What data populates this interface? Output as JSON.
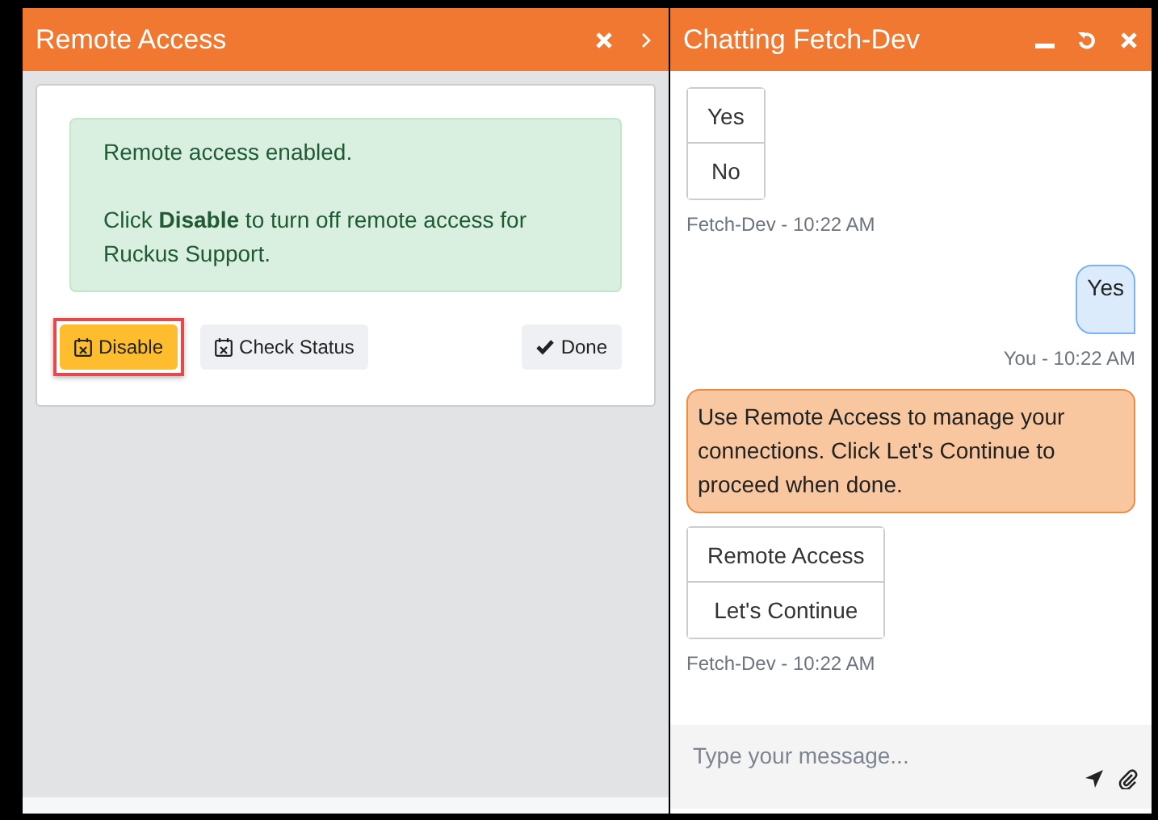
{
  "remote_panel": {
    "title": "Remote Access",
    "alert": {
      "lines": [
        "Remote access enabled.",
        "Click **Disable** to turn off remote access for Ruckus Support."
      ]
    },
    "buttons": [
      {
        "label": "Disable",
        "kind": "warning",
        "highlighted": true
      },
      {
        "label": "Check Status",
        "kind": "light",
        "highlighted": false
      },
      {
        "label": "Done",
        "kind": "light",
        "highlighted": false
      }
    ]
  },
  "chat_panel": {
    "title": "Chatting Fetch-Dev",
    "messages": [
      {
        "kind": "options",
        "options": [
          "Yes",
          "No"
        ],
        "meta": "Fetch-Dev - 10:22 AM"
      },
      {
        "kind": "user",
        "text": "Yes",
        "meta": "You - 10:22 AM"
      },
      {
        "kind": "bot",
        "text": "Use Remote Access to manage your connections. Click Let's Continue to proceed when done."
      },
      {
        "kind": "options",
        "options": [
          "Remote Access",
          "Let's Continue"
        ],
        "meta": "Fetch-Dev - 10:22 AM"
      }
    ],
    "input": {
      "placeholder": "Type your message..."
    }
  }
}
